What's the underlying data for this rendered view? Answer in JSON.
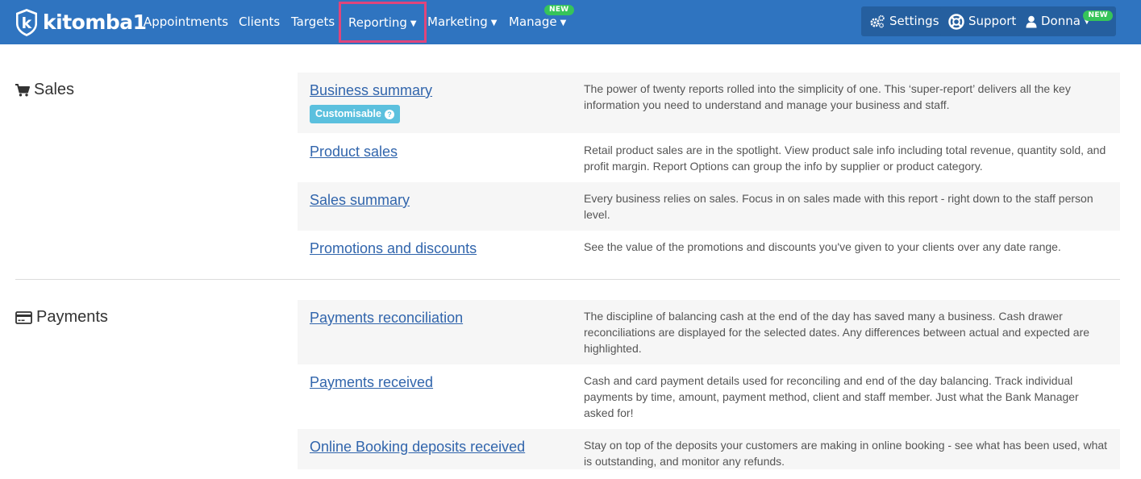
{
  "brand": {
    "name": "kitomba1",
    "logo_letter": "k"
  },
  "nav": {
    "appointments": "Appointments",
    "clients": "Clients",
    "targets": "Targets",
    "reporting": "Reporting",
    "marketing": "Marketing",
    "manage": "Manage",
    "manage_badge": "NEW",
    "settings": "Settings",
    "support": "Support",
    "user": "Donna",
    "user_badge": "NEW"
  },
  "colors": {
    "navbar": "#2f74c0",
    "active_highlight": "#e0457b",
    "link": "#3165ac",
    "badge_new": "#36c45a",
    "badge_customisable": "#5bc0de"
  },
  "sections": {
    "sales": {
      "title": "Sales",
      "icon": "cart-icon",
      "reports": [
        {
          "name": "Business summary",
          "badge": "Customisable",
          "description": "The power of twenty reports rolled into the simplicity of one. This ‘super-report’ delivers all the key information you need to understand and manage your business and staff."
        },
        {
          "name": "Product sales",
          "description": "Retail product sales are in the spotlight. View product sale info including total revenue, quantity sold, and profit margin. Report Options can group the info by supplier or product category."
        },
        {
          "name": "Sales summary",
          "description": "Every business relies on sales. Focus in on sales made with this report - right down to the staff person level."
        },
        {
          "name": "Promotions and discounts",
          "description": "See the value of the promotions and discounts you've given to your clients over any date range."
        }
      ]
    },
    "payments": {
      "title": "Payments",
      "icon": "credit-card-icon",
      "reports": [
        {
          "name": "Payments reconciliation",
          "description": "The discipline of balancing cash at the end of the day has saved many a business. Cash drawer reconciliations are displayed for the selected dates. Any differences between actual and expected are highlighted."
        },
        {
          "name": "Payments received",
          "description": "Cash and card payment details used for reconciling and end of the day balancing. Track individual payments by time, amount, payment method, client and staff member. Just what the Bank Manager asked for!"
        },
        {
          "name": "Online Booking deposits received",
          "description": "Stay on top of the deposits your customers are making in online booking - see what has been used, what is outstanding, and monitor any refunds."
        }
      ]
    }
  }
}
